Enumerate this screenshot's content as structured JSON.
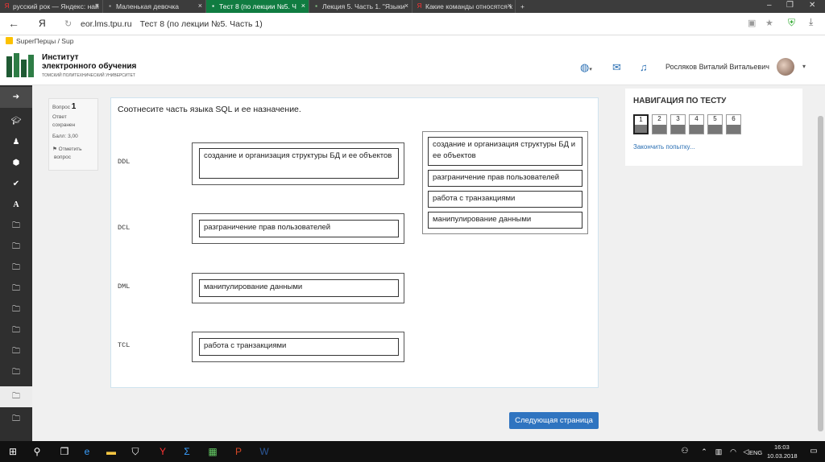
{
  "browser": {
    "tabs": [
      {
        "label": "русский рок — Яндекс: най"
      },
      {
        "label": "Маленькая девочка"
      },
      {
        "label": "Тест 8 (по лекции №5. Ч"
      },
      {
        "label": "Лекция 5. Часть 1. \"Языки"
      },
      {
        "label": "Какие команды относятся к"
      }
    ],
    "address": "eor.lms.tpu.ru",
    "page_title": "Тест 8 (по лекции №5. Часть 1)",
    "bookmark": "SuperПерцы / Sup"
  },
  "header": {
    "brand_line1": "Институт",
    "brand_line2": "электронного обучения",
    "brand_sub": "ТОМСКИЙ ПОЛИТЕХНИЧЕСКИЙ УНИВЕРСИТЕТ",
    "user_name": "Росляков Виталий Витальевич"
  },
  "question_info": {
    "label": "Вопрос",
    "number": "1",
    "status_line1": "Ответ",
    "status_line2": "сохранен",
    "score": "Балл: 3,00",
    "flag_line1": "Отметить",
    "flag_line2": "вопрос"
  },
  "question": {
    "text": "Соотнесите часть языка SQL и ее назначение.",
    "pairs": [
      {
        "term": "DDL",
        "answer": "создание и организация структуры БД и ее объектов"
      },
      {
        "term": "DCL",
        "answer": "разграничение прав пользователей"
      },
      {
        "term": "DML",
        "answer": "манипулирование данными"
      },
      {
        "term": "TCL",
        "answer": "работа с транзакциями"
      }
    ],
    "pool": [
      "создание и организация структуры БД и ее объектов",
      "разграничение прав пользователей",
      "работа с транзакциями",
      "манипулирование данными"
    ]
  },
  "next_button": "Следующая страница",
  "navigation": {
    "title": "НАВИГАЦИЯ ПО ТЕСТУ",
    "pages": [
      "1",
      "2",
      "3",
      "4",
      "5",
      "6"
    ],
    "finish_link": "Закончить попытку..."
  },
  "taskbar": {
    "lang": "ENG",
    "time": "16:03",
    "date": "10.03.2018"
  }
}
